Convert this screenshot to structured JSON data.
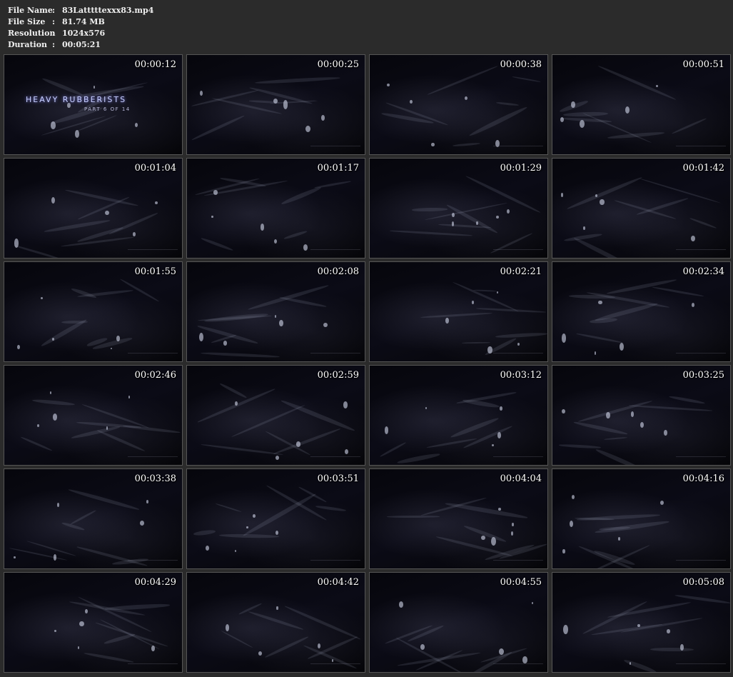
{
  "file_info": {
    "name_label": "File Name",
    "name_value": "83Latttttexxx83.mp4",
    "size_label": "File Size",
    "size_value": "81.74 MB",
    "resolution_label": "Resolution",
    "resolution_value": "1024x576",
    "duration_label": "Duration",
    "duration_value": "00:05:21",
    "separator": ":"
  },
  "title_card": {
    "title": "HEAVY RUBBERISTS",
    "subtitle": "PART 6 OF 14"
  },
  "thumbnails": [
    {
      "timestamp": "00:00:12"
    },
    {
      "timestamp": "00:00:25"
    },
    {
      "timestamp": "00:00:38"
    },
    {
      "timestamp": "00:00:51"
    },
    {
      "timestamp": "00:01:04"
    },
    {
      "timestamp": "00:01:17"
    },
    {
      "timestamp": "00:01:29"
    },
    {
      "timestamp": "00:01:42"
    },
    {
      "timestamp": "00:01:55"
    },
    {
      "timestamp": "00:02:08"
    },
    {
      "timestamp": "00:02:21"
    },
    {
      "timestamp": "00:02:34"
    },
    {
      "timestamp": "00:02:46"
    },
    {
      "timestamp": "00:02:59"
    },
    {
      "timestamp": "00:03:12"
    },
    {
      "timestamp": "00:03:25"
    },
    {
      "timestamp": "00:03:38"
    },
    {
      "timestamp": "00:03:51"
    },
    {
      "timestamp": "00:04:04"
    },
    {
      "timestamp": "00:04:16"
    },
    {
      "timestamp": "00:04:29"
    },
    {
      "timestamp": "00:04:42"
    },
    {
      "timestamp": "00:04:55"
    },
    {
      "timestamp": "00:05:08"
    }
  ]
}
